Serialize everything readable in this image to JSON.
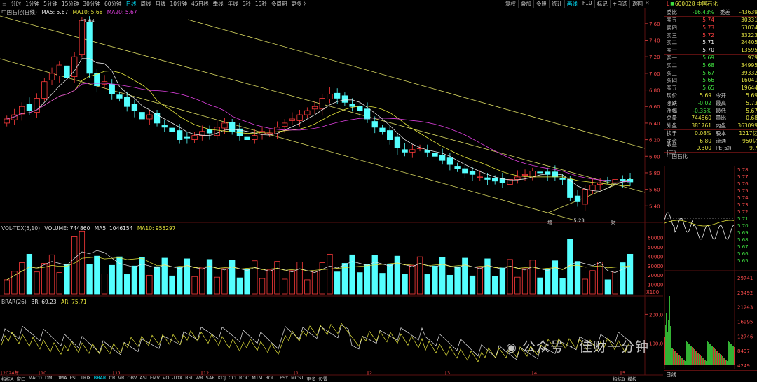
{
  "toolbar": {
    "periods": [
      "分时",
      "1分钟",
      "5分钟",
      "15分钟",
      "30分钟",
      "60分钟",
      "日线",
      "周线",
      "月线",
      "10分钟",
      "45日线",
      "季线",
      "年线",
      "5秒",
      "15秒",
      "多周期",
      "更多 〉"
    ],
    "active_period": 6,
    "tools": [
      "复权",
      "叠加",
      "多股",
      "统计",
      "画线",
      "F10",
      "标记",
      "+自选",
      "返回"
    ],
    "active_tool": 4
  },
  "main_legend": {
    "name": "中国石化(日线)",
    "ma5": "MA5: 5.67",
    "ma10": "MA10: 5.68",
    "ma20": "MA20: 5.67"
  },
  "vol_legend": {
    "name": "VOL-TDX(5,10)",
    "volume": "VOLUME: 744860",
    "ma5": "MA5: 1046154",
    "ma10": "MA10: 955297"
  },
  "brar_legend": {
    "name": "BRAR(26)",
    "br": "BR: 69.23",
    "ar": "AR: 75.71"
  },
  "price_axis": [
    "7.60",
    "7.40",
    "7.20",
    "7.00",
    "6.80",
    "6.60",
    "6.40",
    "6.20",
    "6.00",
    "5.80",
    "5.60",
    "5.40"
  ],
  "vol_axis": [
    "60000",
    "50000",
    "40000",
    "30000",
    "20000",
    "10000",
    "X100"
  ],
  "brar_axis": [
    "200.0",
    "100.0"
  ],
  "x_axis": [
    "2024年",
    "10",
    "11",
    "12",
    "1",
    "2",
    "3",
    "4",
    "5"
  ],
  "annotations": {
    "high": "7.64",
    "low": "5.23",
    "tag1": "增",
    "tag2": "财"
  },
  "colors": {
    "up": "#ff3b3b",
    "down": "#54ffff",
    "ma5": "#e8e8e8",
    "ma10": "#e6e63c",
    "ma20": "#e040e0",
    "grid": "#5a1010",
    "channel": "#d8d860"
  },
  "quote": {
    "stock": "600028 中国石化",
    "weibi_label": "委比",
    "weibi": "-16.43%",
    "weicha_label": "委差",
    "weicha": "-43639",
    "asks": [
      {
        "label": "卖五",
        "price": "5.74",
        "vol": "30331"
      },
      {
        "label": "卖四",
        "price": "5.73",
        "vol": "53074"
      },
      {
        "label": "卖三",
        "price": "5.72",
        "vol": "33223"
      },
      {
        "label": "卖二",
        "price": "5.71",
        "vol": "24405"
      },
      {
        "label": "卖一",
        "price": "5.70",
        "vol": "13595"
      }
    ],
    "bids": [
      {
        "label": "买一",
        "price": "5.69",
        "vol": "979"
      },
      {
        "label": "买二",
        "price": "5.68",
        "vol": "34995"
      },
      {
        "label": "买三",
        "price": "5.67",
        "vol": "39332"
      },
      {
        "label": "买四",
        "price": "5.66",
        "vol": "16041"
      },
      {
        "label": "买五",
        "price": "5.65",
        "vol": "19644"
      }
    ],
    "stats": [
      {
        "a": "现价",
        "b": "5.69",
        "c": "今开",
        "d": "5.69"
      },
      {
        "a": "涨跌",
        "b": "-0.02",
        "c": "最高",
        "d": "5.73"
      },
      {
        "a": "涨幅",
        "b": "-0.35%",
        "c": "最低",
        "d": "5.67"
      },
      {
        "a": "总量",
        "b": "744860",
        "c": "量比",
        "d": "0.68"
      },
      {
        "a": "外盘",
        "b": "381761",
        "c": "内盘",
        "d": "363099"
      }
    ],
    "stats2": [
      {
        "a": "换手",
        "b": "0.08%",
        "c": "股本",
        "d": "1217亿"
      },
      {
        "a": "净资",
        "b": "6.80",
        "c": "流通",
        "d": "950亿"
      },
      {
        "a": "收益(二)",
        "b": "0.300",
        "c": "PE(动)",
        "d": "9.7"
      }
    ],
    "mini_title": "中国石化",
    "mini_axis": [
      "5.78",
      "5.77",
      "5.76",
      "5.75",
      "5.74",
      "5.73",
      "5.72",
      "5.71",
      "5.70",
      "5.69",
      "5.68",
      "5.67",
      "5.66",
      "5.65"
    ],
    "mini_vol_axis": [
      "29741",
      "25492",
      "21243",
      "16995",
      "12746",
      "8497",
      "4249"
    ],
    "bottom_tab": "日线"
  },
  "bottom_tabs": [
    "指标A",
    "窗口",
    "MACD",
    "DMI",
    "DMA",
    "FSL",
    "TRIX",
    "BRAR",
    "CR",
    "VR",
    "OBV",
    "ASI",
    "EMV",
    "VOL-TDX",
    "RSI",
    "WR",
    "SAR",
    "KDJ",
    "CCI",
    "ROC",
    "MTM",
    "BOLL",
    "PSY",
    "MCST",
    "更多",
    "设置"
  ],
  "bottom_active": 7,
  "bottom_right": [
    "指标B",
    "模板"
  ],
  "watermark": "公众号 · 佳财一分钟",
  "chart_data": {
    "type": "candlestick",
    "note_units": "price in CNY",
    "ylim": [
      5.2,
      7.7
    ],
    "close_series_approx": [
      6.45,
      6.5,
      6.6,
      6.55,
      6.7,
      6.9,
      7.0,
      7.1,
      6.95,
      7.2,
      7.64,
      7.0,
      6.85,
      6.9,
      6.75,
      6.7,
      6.6,
      6.55,
      6.45,
      6.5,
      6.4,
      6.35,
      6.3,
      6.2,
      6.22,
      6.25,
      6.3,
      6.28,
      6.35,
      6.4,
      6.3,
      6.25,
      6.2,
      6.25,
      6.3,
      6.28,
      6.35,
      6.4,
      6.45,
      6.5,
      6.55,
      6.6,
      6.7,
      6.75,
      6.7,
      6.65,
      6.6,
      6.55,
      6.45,
      6.35,
      6.3,
      6.2,
      6.1,
      6.05,
      6.08,
      6.1,
      6.05,
      6.0,
      5.95,
      5.9,
      5.85,
      5.8,
      5.78,
      5.75,
      5.72,
      5.7,
      5.68,
      5.72,
      5.75,
      5.78,
      5.82,
      5.8,
      5.78,
      5.75,
      5.72,
      5.5,
      5.45,
      5.6,
      5.65,
      5.68,
      5.7,
      5.72,
      5.7,
      5.69
    ]
  }
}
